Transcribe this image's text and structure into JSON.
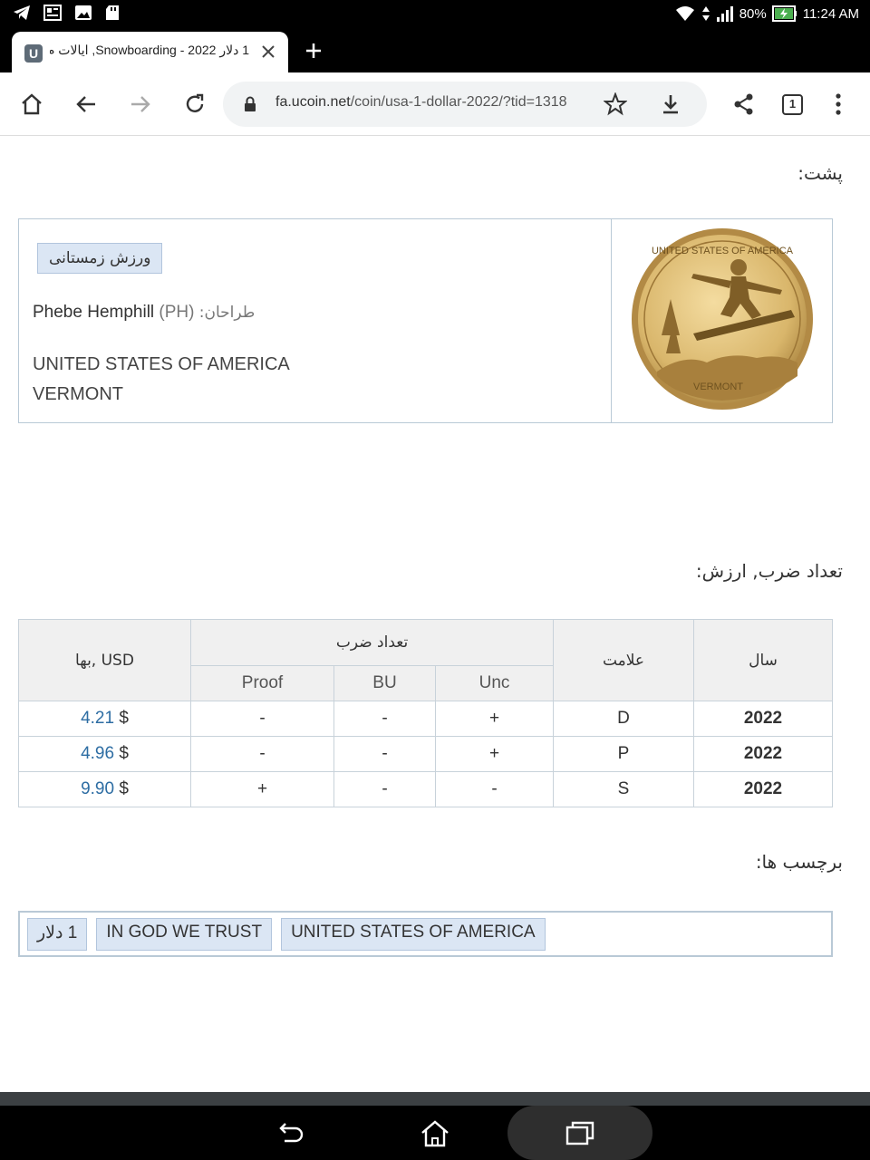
{
  "status_bar": {
    "battery": "80%",
    "time": "11:24 AM"
  },
  "tab": {
    "title": "1 دلار 2022 - Snowboarding, ایالات م",
    "favicon_letter": "U"
  },
  "toolbar": {
    "url_host": "fa.ucoin.net",
    "url_path": "/coin/usa-1-dollar-2022/?tid=1318",
    "tab_count": "1"
  },
  "reverse": {
    "heading": "پشت:",
    "category_tag": "ورزش زمستانی",
    "designer_label": "طراحان:",
    "designer_code": "(PH)",
    "designer_name": "Phebe Hemphill",
    "inscription_line1": "UNITED STATES OF AMERICA",
    "inscription_line2": "VERMONT",
    "coin_image_icon": "snowboarder-coin"
  },
  "mintage": {
    "heading": "تعداد ضرب, ارزش:",
    "headers": {
      "year": "سال",
      "mark": "علامت",
      "mintage": "تعداد ضرب",
      "price": "بها, USD",
      "unc": "Unc",
      "bu": "BU",
      "proof": "Proof"
    },
    "rows": [
      {
        "year": "2022",
        "mark": "D",
        "unc": "+",
        "bu": "-",
        "proof": "-",
        "currency": "$",
        "price": "4.21"
      },
      {
        "year": "2022",
        "mark": "P",
        "unc": "+",
        "bu": "-",
        "proof": "-",
        "currency": "$",
        "price": "4.96"
      },
      {
        "year": "2022",
        "mark": "S",
        "unc": "-",
        "bu": "-",
        "proof": "+",
        "currency": "$",
        "price": "9.90"
      }
    ]
  },
  "tags": {
    "heading": "برچسب ها:",
    "items": [
      "1 دلار",
      "IN GOD WE TRUST",
      "UNITED STATES OF AMERICA"
    ]
  },
  "colors": {
    "link": "#2d6da3",
    "tag_bg": "#dbe6f4",
    "border": "#b9c9d6"
  }
}
